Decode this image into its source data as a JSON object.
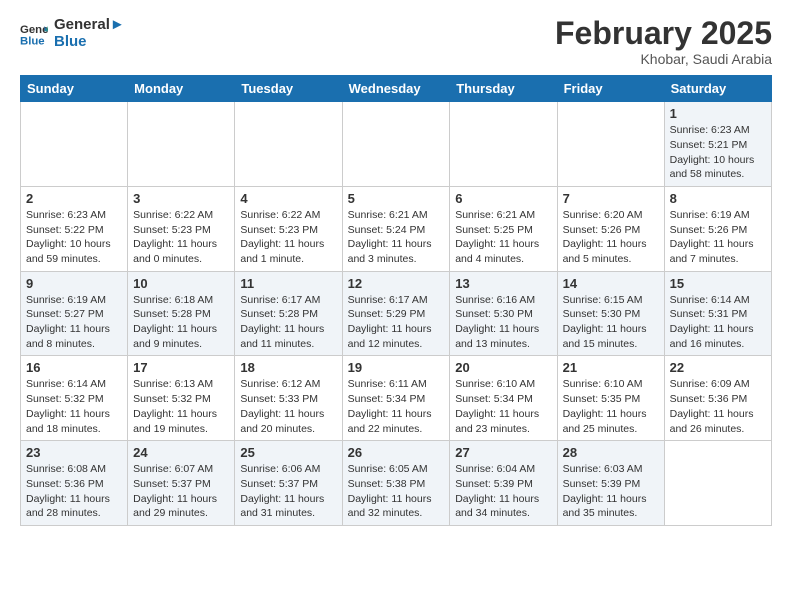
{
  "header": {
    "logo": {
      "line1": "General",
      "line2": "Blue"
    },
    "title": "February 2025",
    "subtitle": "Khobar, Saudi Arabia"
  },
  "weekdays": [
    "Sunday",
    "Monday",
    "Tuesday",
    "Wednesday",
    "Thursday",
    "Friday",
    "Saturday"
  ],
  "weeks": [
    [
      {
        "day": "",
        "info": ""
      },
      {
        "day": "",
        "info": ""
      },
      {
        "day": "",
        "info": ""
      },
      {
        "day": "",
        "info": ""
      },
      {
        "day": "",
        "info": ""
      },
      {
        "day": "",
        "info": ""
      },
      {
        "day": "1",
        "info": "Sunrise: 6:23 AM\nSunset: 5:21 PM\nDaylight: 10 hours\nand 58 minutes."
      }
    ],
    [
      {
        "day": "2",
        "info": "Sunrise: 6:23 AM\nSunset: 5:22 PM\nDaylight: 10 hours\nand 59 minutes."
      },
      {
        "day": "3",
        "info": "Sunrise: 6:22 AM\nSunset: 5:23 PM\nDaylight: 11 hours\nand 0 minutes."
      },
      {
        "day": "4",
        "info": "Sunrise: 6:22 AM\nSunset: 5:23 PM\nDaylight: 11 hours\nand 1 minute."
      },
      {
        "day": "5",
        "info": "Sunrise: 6:21 AM\nSunset: 5:24 PM\nDaylight: 11 hours\nand 3 minutes."
      },
      {
        "day": "6",
        "info": "Sunrise: 6:21 AM\nSunset: 5:25 PM\nDaylight: 11 hours\nand 4 minutes."
      },
      {
        "day": "7",
        "info": "Sunrise: 6:20 AM\nSunset: 5:26 PM\nDaylight: 11 hours\nand 5 minutes."
      },
      {
        "day": "8",
        "info": "Sunrise: 6:19 AM\nSunset: 5:26 PM\nDaylight: 11 hours\nand 7 minutes."
      }
    ],
    [
      {
        "day": "9",
        "info": "Sunrise: 6:19 AM\nSunset: 5:27 PM\nDaylight: 11 hours\nand 8 minutes."
      },
      {
        "day": "10",
        "info": "Sunrise: 6:18 AM\nSunset: 5:28 PM\nDaylight: 11 hours\nand 9 minutes."
      },
      {
        "day": "11",
        "info": "Sunrise: 6:17 AM\nSunset: 5:28 PM\nDaylight: 11 hours\nand 11 minutes."
      },
      {
        "day": "12",
        "info": "Sunrise: 6:17 AM\nSunset: 5:29 PM\nDaylight: 11 hours\nand 12 minutes."
      },
      {
        "day": "13",
        "info": "Sunrise: 6:16 AM\nSunset: 5:30 PM\nDaylight: 11 hours\nand 13 minutes."
      },
      {
        "day": "14",
        "info": "Sunrise: 6:15 AM\nSunset: 5:30 PM\nDaylight: 11 hours\nand 15 minutes."
      },
      {
        "day": "15",
        "info": "Sunrise: 6:14 AM\nSunset: 5:31 PM\nDaylight: 11 hours\nand 16 minutes."
      }
    ],
    [
      {
        "day": "16",
        "info": "Sunrise: 6:14 AM\nSunset: 5:32 PM\nDaylight: 11 hours\nand 18 minutes."
      },
      {
        "day": "17",
        "info": "Sunrise: 6:13 AM\nSunset: 5:32 PM\nDaylight: 11 hours\nand 19 minutes."
      },
      {
        "day": "18",
        "info": "Sunrise: 6:12 AM\nSunset: 5:33 PM\nDaylight: 11 hours\nand 20 minutes."
      },
      {
        "day": "19",
        "info": "Sunrise: 6:11 AM\nSunset: 5:34 PM\nDaylight: 11 hours\nand 22 minutes."
      },
      {
        "day": "20",
        "info": "Sunrise: 6:10 AM\nSunset: 5:34 PM\nDaylight: 11 hours\nand 23 minutes."
      },
      {
        "day": "21",
        "info": "Sunrise: 6:10 AM\nSunset: 5:35 PM\nDaylight: 11 hours\nand 25 minutes."
      },
      {
        "day": "22",
        "info": "Sunrise: 6:09 AM\nSunset: 5:36 PM\nDaylight: 11 hours\nand 26 minutes."
      }
    ],
    [
      {
        "day": "23",
        "info": "Sunrise: 6:08 AM\nSunset: 5:36 PM\nDaylight: 11 hours\nand 28 minutes."
      },
      {
        "day": "24",
        "info": "Sunrise: 6:07 AM\nSunset: 5:37 PM\nDaylight: 11 hours\nand 29 minutes."
      },
      {
        "day": "25",
        "info": "Sunrise: 6:06 AM\nSunset: 5:37 PM\nDaylight: 11 hours\nand 31 minutes."
      },
      {
        "day": "26",
        "info": "Sunrise: 6:05 AM\nSunset: 5:38 PM\nDaylight: 11 hours\nand 32 minutes."
      },
      {
        "day": "27",
        "info": "Sunrise: 6:04 AM\nSunset: 5:39 PM\nDaylight: 11 hours\nand 34 minutes."
      },
      {
        "day": "28",
        "info": "Sunrise: 6:03 AM\nSunset: 5:39 PM\nDaylight: 11 hours\nand 35 minutes."
      },
      {
        "day": "",
        "info": ""
      }
    ]
  ]
}
